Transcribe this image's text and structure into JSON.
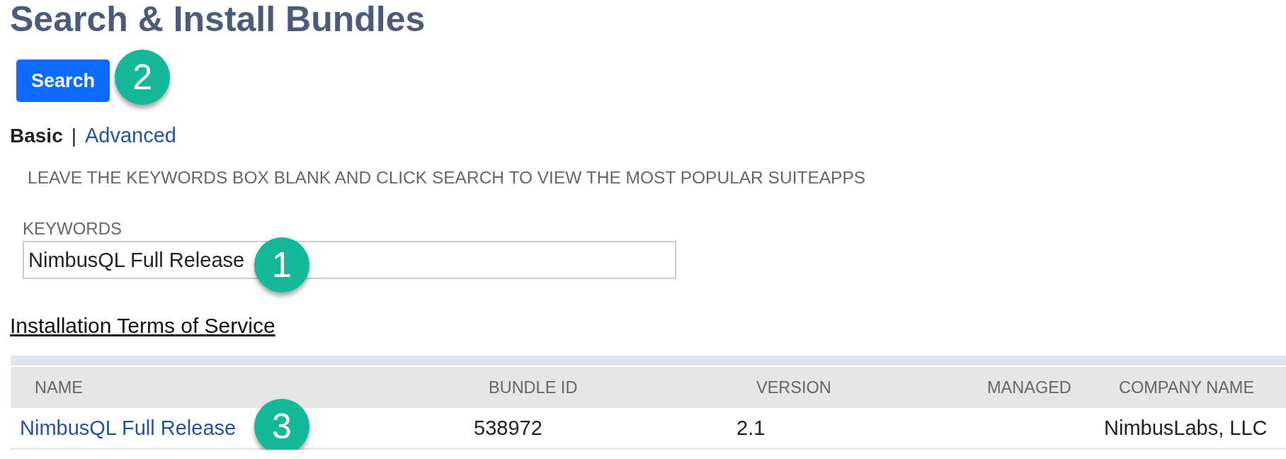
{
  "title": "Search & Install Bundles",
  "search_button": {
    "label": "Search",
    "callout": "2"
  },
  "mode_tabs": [
    {
      "label": "Basic",
      "selected": true
    },
    {
      "label": "Advanced",
      "selected": false
    }
  ],
  "mode_separator": "|",
  "instruction": "LEAVE THE KEYWORDS BOX BLANK AND CLICK SEARCH TO VIEW THE MOST POPULAR SUITEAPPS",
  "keywords": {
    "label": "KEYWORDS",
    "value": "NimbusQL Full Release",
    "callout": "1"
  },
  "terms_link": "Installation Terms of Service",
  "table": {
    "columns": [
      "NAME",
      "BUNDLE ID",
      "VERSION",
      "MANAGED",
      "COMPANY NAME"
    ],
    "rows": [
      {
        "name": "NimbusQL Full Release",
        "bundle_id": "538972",
        "version": "2.1",
        "company_name": "NimbusLabs, LLC",
        "callout": "3"
      }
    ]
  }
}
